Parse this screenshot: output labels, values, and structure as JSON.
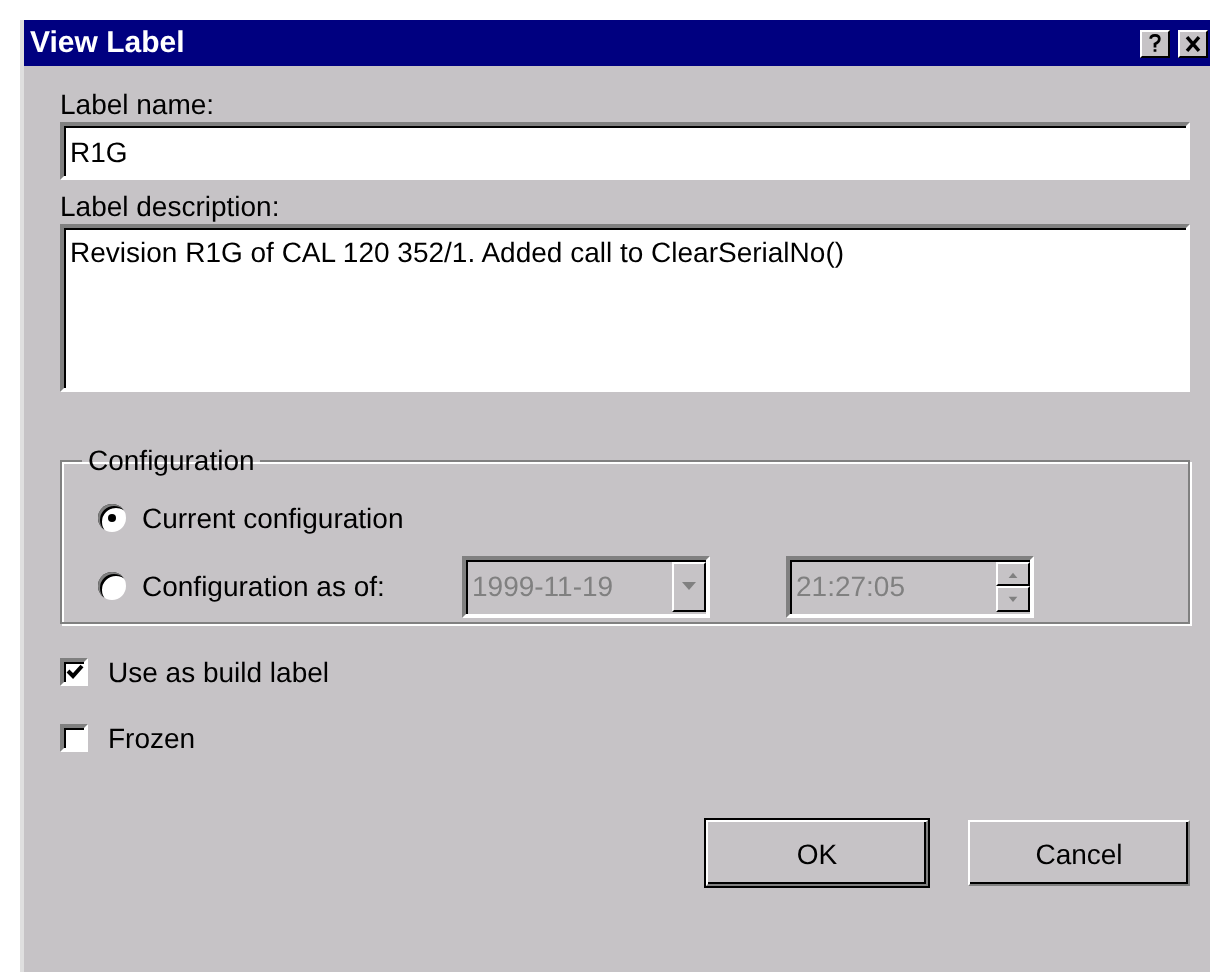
{
  "window": {
    "title": "View Label"
  },
  "label_name": {
    "label": "Label name:",
    "value": "R1G"
  },
  "label_description": {
    "label": "Label description:",
    "value": "Revision R1G of CAL 120 352/1. Added call to ClearSerialNo()"
  },
  "configuration": {
    "title": "Configuration",
    "options": [
      {
        "label": "Current configuration",
        "selected": true
      },
      {
        "label": "Configuration as of:",
        "selected": false
      }
    ],
    "date": {
      "value": "1999-11-19",
      "disabled": true
    },
    "time": {
      "value": "21:27:05",
      "disabled": true
    }
  },
  "checkboxes": [
    {
      "label": "Use as build label",
      "checked": true
    },
    {
      "label": "Frozen",
      "checked": false
    }
  ],
  "buttons": [
    {
      "label": "OK",
      "default": true
    },
    {
      "label": "Cancel",
      "default": false
    }
  ]
}
